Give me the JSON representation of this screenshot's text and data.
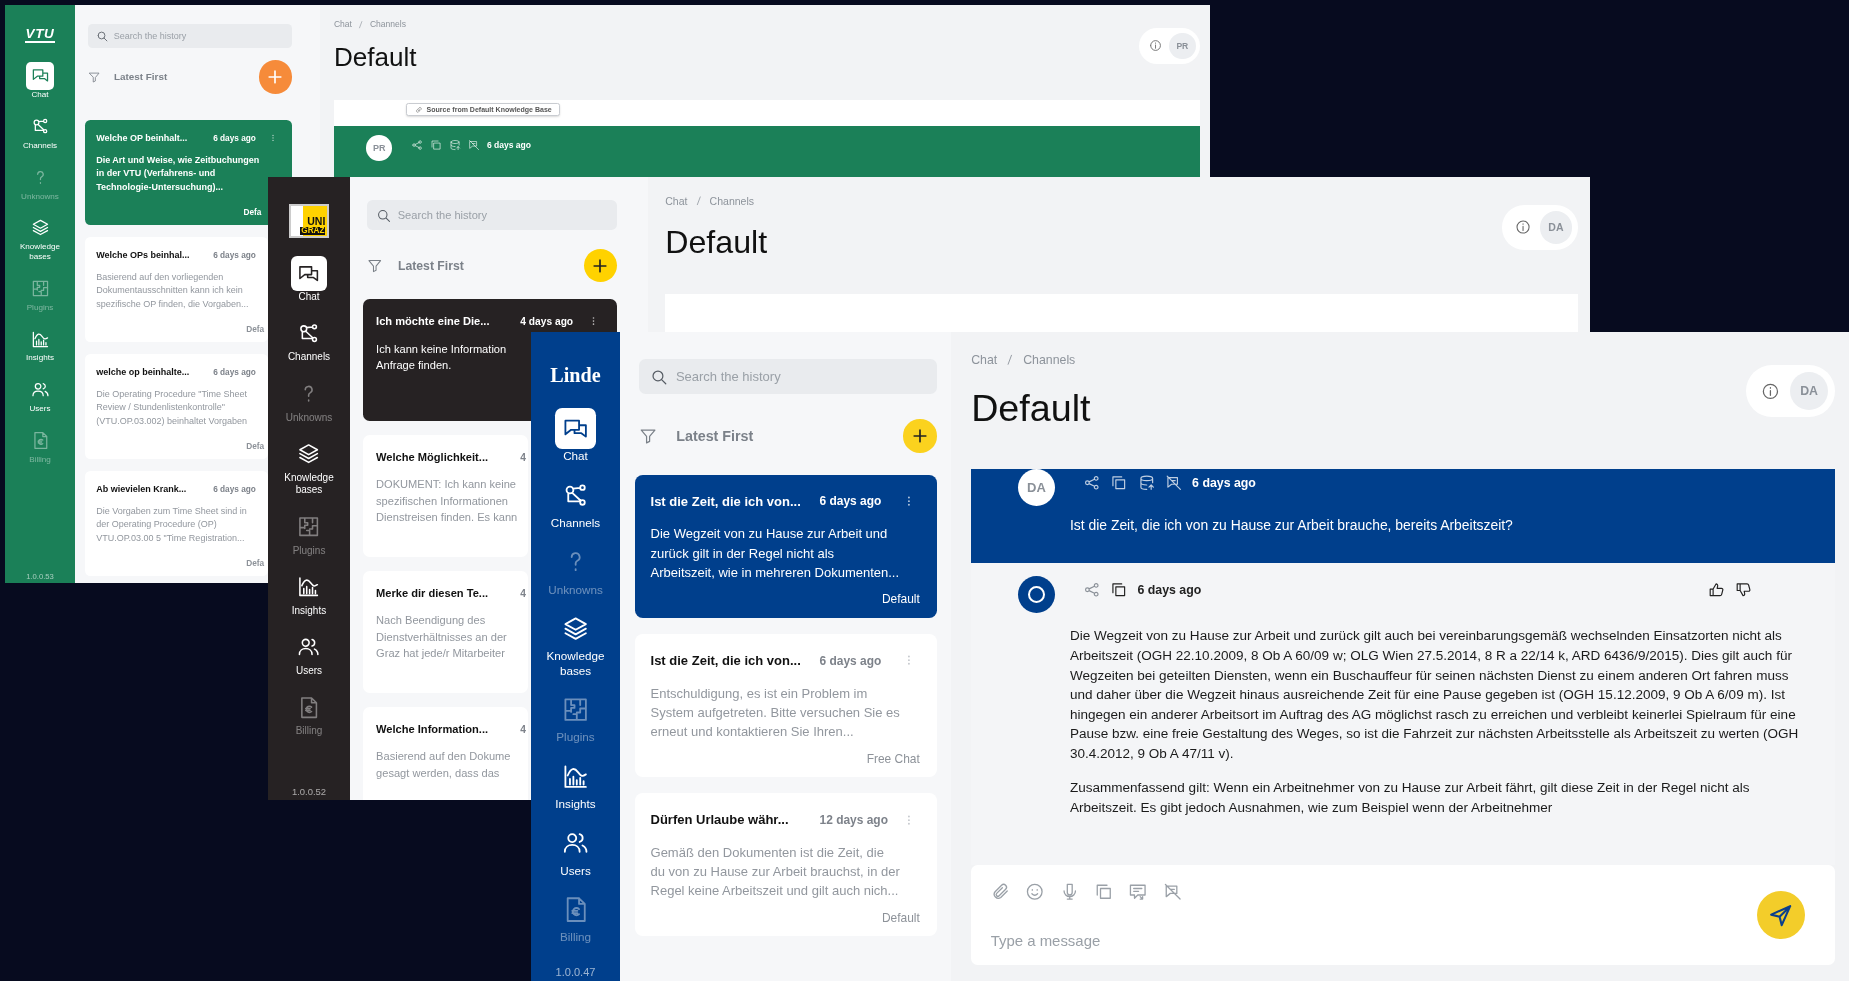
{
  "windows": [
    {
      "logo": [
        "VTU"
      ],
      "nav": [
        {
          "label": "Chat",
          "selected": true,
          "disabled": false
        },
        {
          "label": "Channels",
          "selected": false,
          "disabled": false
        },
        {
          "label": "Unknowns",
          "selected": false,
          "disabled": true
        },
        {
          "label": "Knowledge bases",
          "selected": false,
          "disabled": false
        },
        {
          "label": "Plugins",
          "selected": false,
          "disabled": true
        },
        {
          "label": "Insights",
          "selected": false,
          "disabled": false
        },
        {
          "label": "Users",
          "selected": false,
          "disabled": false
        },
        {
          "label": "Billing",
          "selected": false,
          "disabled": true
        }
      ],
      "version": "1.0.0.53",
      "history": {
        "search": {
          "placeholder": "Search the history"
        },
        "sort": "Latest First",
        "cards": [
          {
            "title": "Welche OP beinhalt...",
            "time": "6 days ago",
            "lines": [
              "Die Art und Weise, wie Zeitbuchungen",
              "in der VTU (Verfahrens- und",
              "Technologie-Untersuchung)..."
            ],
            "channel": "Defa",
            "selected": true
          },
          {
            "title": "Welche OPs beinhal...",
            "time": "6 days ago",
            "lines": [
              "Basierend auf den vorliegenden",
              "Dokumentausschnitten kann ich kein",
              "spezifische OP finden, die Vorgaben..."
            ],
            "channel": "Defa",
            "selected": false
          },
          {
            "title": "welche op beinhalte...",
            "time": "6 days ago",
            "lines": [
              "Die Operating Procedure \"Time Sheet",
              "Review / Stundenlistenkontrolle\"",
              "(VTU.OP.03.002) beinhaltet Vorgaben"
            ],
            "channel": "Defa",
            "selected": false
          },
          {
            "title": "Ab wievielen Krank...",
            "time": "6 days ago",
            "lines": [
              "Die Vorgaben zum Time Sheet sind in",
              "der Operating Procedure (OP)",
              "VTU.OP.03.00 5 \"Time Registration..."
            ],
            "channel": "Defa",
            "selected": false
          }
        ]
      },
      "breadcrumb": [
        "Chat",
        "Channels"
      ],
      "title": "Default",
      "avatar": "PR",
      "messages": [
        {
          "kind": "source",
          "label": "Source from Default Knowledge Base"
        },
        {
          "kind": "user",
          "avatar": "PR",
          "time": "6 days ago"
        }
      ]
    },
    {
      "logo": [
        "UNI",
        "GRAZ"
      ],
      "nav": [
        {
          "label": "Chat",
          "selected": true,
          "disabled": false
        },
        {
          "label": "Channels",
          "selected": false,
          "disabled": false
        },
        {
          "label": "Unknowns",
          "selected": false,
          "disabled": true
        },
        {
          "label": "Knowledge bases",
          "selected": false,
          "disabled": false
        },
        {
          "label": "Plugins",
          "selected": false,
          "disabled": true
        },
        {
          "label": "Insights",
          "selected": false,
          "disabled": false
        },
        {
          "label": "Users",
          "selected": false,
          "disabled": false
        },
        {
          "label": "Billing",
          "selected": false,
          "disabled": true
        }
      ],
      "version": "1.0.0.52",
      "history": {
        "search": {
          "placeholder": "Search the history"
        },
        "sort": "Latest First",
        "cards": [
          {
            "title": "Ich möchte eine Die...",
            "time": "4 days ago",
            "lines": [
              "Ich kann keine Information",
              "Anfrage finden."
            ],
            "selected": true
          },
          {
            "title": "Welche Möglichkeit...",
            "time": "4",
            "lines": [
              "DOKUMENT: Ich kann keine",
              "spezifischen Informationen",
              "Dienstreisen finden. Es kann"
            ],
            "selected": false
          },
          {
            "title": "Merke dir diesen Te...",
            "time": "4",
            "lines": [
              "Nach Beendigung des",
              "Dienstverhältnisses an der",
              "Graz hat jede/r Mitarbeiter"
            ],
            "selected": false
          },
          {
            "title": "Welche Information...",
            "time": "4",
            "lines": [
              "Basierend auf den Dokume",
              "gesagt werden, dass das"
            ],
            "selected": false
          }
        ]
      },
      "breadcrumb": [
        "Chat",
        "Channels"
      ],
      "title": "Default",
      "avatar": "DA"
    },
    {
      "logo": [
        "Linde"
      ],
      "nav": [
        {
          "label": "Chat",
          "selected": true,
          "disabled": false
        },
        {
          "label": "Channels",
          "selected": false,
          "disabled": false
        },
        {
          "label": "Unknowns",
          "selected": false,
          "disabled": true
        },
        {
          "label": "Knowledge bases",
          "selected": false,
          "disabled": false
        },
        {
          "label": "Plugins",
          "selected": false,
          "disabled": true
        },
        {
          "label": "Insights",
          "selected": false,
          "disabled": false
        },
        {
          "label": "Users",
          "selected": false,
          "disabled": false
        },
        {
          "label": "Billing",
          "selected": false,
          "disabled": true
        }
      ],
      "version": "1.0.0.47",
      "history": {
        "search": {
          "placeholder": "Search the history"
        },
        "sort": "Latest First",
        "cards": [
          {
            "title": "Ist die Zeit, die ich von...",
            "time": "6 days ago",
            "lines": [
              "Die Wegzeit von zu Hause zur Arbeit und",
              "zurück gilt in der Regel nicht als",
              "Arbeitszeit, wie in mehreren Dokumenten..."
            ],
            "channel": "Default",
            "selected": true
          },
          {
            "title": "Ist die Zeit, die ich von...",
            "time": "6 days ago",
            "lines": [
              "Entschuldigung, es ist ein Problem im",
              "System aufgetreten. Bitte versuchen Sie es",
              "erneut und kontaktieren Sie Ihren..."
            ],
            "channel": "Free Chat",
            "selected": false
          },
          {
            "title": "Dürfen Urlaube währ...",
            "time": "12 days ago",
            "lines": [
              "Gemäß den Dokumenten ist die Zeit, die",
              "du von zu Hause zur Arbeit brauchst, in der",
              "Regel keine Arbeitszeit und gilt auch nich..."
            ],
            "channel": "Default",
            "selected": false
          }
        ]
      },
      "breadcrumb": [
        "Chat",
        "Channels"
      ],
      "title": "Default",
      "avatar": "DA",
      "messages": [
        {
          "kind": "user",
          "avatar": "DA",
          "time": "6 days ago",
          "text": "Ist die Zeit, die ich von zu Hause zur Arbeit brauche, bereits Arbeitszeit?"
        },
        {
          "kind": "bot",
          "time": "6 days ago",
          "paragraphs": [
            "Die Wegzeit von zu Hause zur Arbeit und zurück gilt auch bei vereinbarungsgemäß wechselnden Einsatzorten nicht als Arbeitszeit (OGH 22.10.2009, 8 Ob A 60/09 w; OLG Wien 27.5.2014, 8 R a 22/14 k, ARD 6436/9/2015). Dies gilt auch für Wegzeiten bei geteilten Diensten, wenn ein Buschauffeur für seinen nächsten Dienst zu einem anderen Ort fahren muss und daher über die Wegzeit hinaus ausreichende Zeit für eine Pause gegeben ist (OGH 15.12.2009, 9 Ob A 6/09 m). Ist hingegen ein anderer Arbeitsort im Auftrag des AG möglichst rasch zu erreichen und verbleibt keinerlei Spielraum für eine Pause bzw. eine freie Gestaltung des Weges, so ist die Fahrzeit zur nächsten Arbeitsstelle als Arbeitszeit zu werten (OGH 30.4.2012, 9 Ob A 47/11 v).",
            "Zusammenfassend gilt: Wenn ein Arbeitnehmer von zu Hause zur Arbeit fährt, gilt diese Zeit in der Regel nicht als Arbeitszeit. Es gibt jedoch Ausnahmen, wie zum Beispiel wenn der Arbeitnehmer"
          ]
        }
      ],
      "composer": {
        "placeholder": "Type a message"
      }
    }
  ]
}
